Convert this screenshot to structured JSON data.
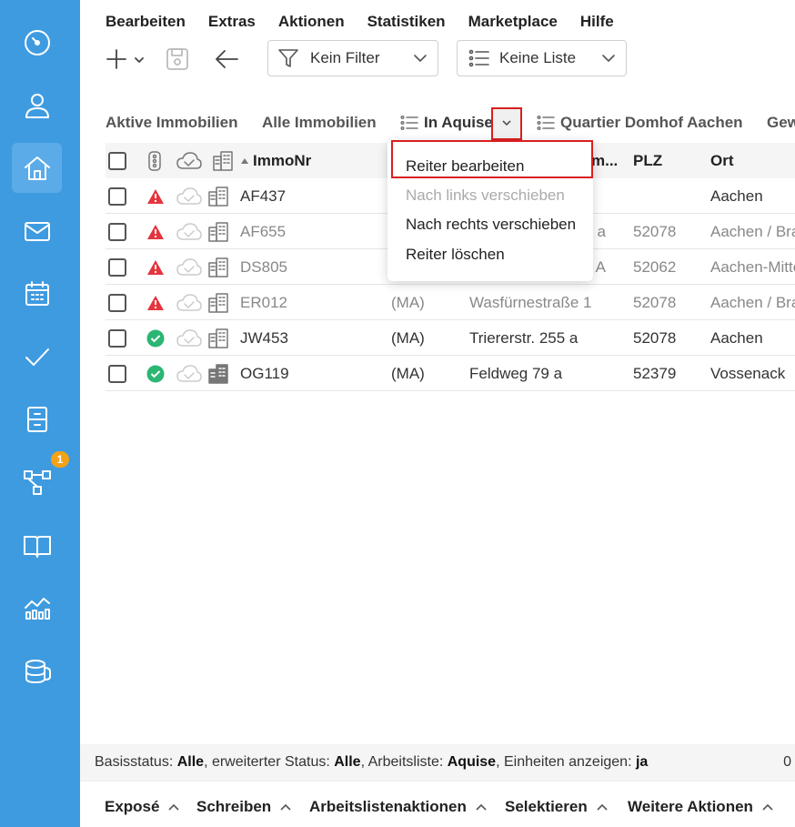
{
  "sidebar": {
    "items": [
      {
        "name": "dashboard-icon"
      },
      {
        "name": "contacts-icon"
      },
      {
        "name": "properties-icon",
        "active": true
      },
      {
        "name": "mail-icon"
      },
      {
        "name": "calendar-icon"
      },
      {
        "name": "tasks-icon"
      },
      {
        "name": "files-icon"
      },
      {
        "name": "process-icon",
        "badge": "1"
      },
      {
        "name": "book-icon"
      },
      {
        "name": "statistics-icon"
      },
      {
        "name": "database-icon"
      }
    ]
  },
  "menubar": {
    "items": [
      "Bearbeiten",
      "Extras",
      "Aktionen",
      "Statistiken",
      "Marketplace",
      "Hilfe"
    ]
  },
  "toolbar": {
    "filter_label": "Kein Filter",
    "list_label": "Keine Liste"
  },
  "tabs": {
    "items": [
      {
        "label": "Aktive Immobilien"
      },
      {
        "label": "Alle Immobilien"
      },
      {
        "label": "In Aquise",
        "active": true
      },
      {
        "label": "Quartier Domhof Aachen"
      },
      {
        "label": "Gew"
      }
    ]
  },
  "table": {
    "headers": {
      "immonr": "ImmoNr",
      "partial": "m...",
      "plz": "PLZ",
      "ort": "Ort"
    },
    "rows": [
      {
        "status": "warning",
        "immonr": "AF437",
        "ma": "",
        "street": "",
        "plz": "",
        "ort": "Aachen",
        "muted": false
      },
      {
        "status": "warning",
        "immonr": "AF655",
        "ma": "",
        "street": "a",
        "plz": "52078",
        "ort": "Aachen / Bra",
        "muted": true
      },
      {
        "status": "warning",
        "immonr": "DS805",
        "ma": "",
        "street": "A",
        "plz": "52062",
        "ort": "Aachen-Mitte",
        "muted": true
      },
      {
        "status": "warning",
        "immonr": "ER012",
        "ma": "(MA)",
        "street": "Wasfürnestraße 1",
        "plz": "52078",
        "ort": "Aachen / Bra",
        "muted": true
      },
      {
        "status": "ok",
        "immonr": "JW453",
        "ma": "(MA)",
        "street": "Triererstr. 255 a",
        "plz": "52078",
        "ort": "Aachen",
        "muted": false
      },
      {
        "status": "ok",
        "immonr": "OG119",
        "ma": "(MA)",
        "street": "Feldweg 79 a",
        "plz": "52379",
        "ort": "Vossenack",
        "muted": false
      }
    ]
  },
  "context_menu": {
    "items": [
      "Reiter bearbeiten",
      "Nach links verschieben",
      "Nach rechts verschieben",
      "Reiter löschen"
    ]
  },
  "status": {
    "basis_label": "Basisstatus:",
    "basis_value": "Alle",
    "erw_label": ", erweiterter Status:",
    "erw_value": "Alle",
    "liste_label": ", Arbeitsliste:",
    "liste_value": "Aquise",
    "einheiten_label": ", Einheiten anzeigen:",
    "einheiten_value": "ja",
    "right_value": "0"
  },
  "bottom": {
    "items": [
      "Exposé",
      "Schreiben",
      "Arbeitslistenaktionen",
      "Selektieren",
      "Weitere Aktionen"
    ]
  },
  "colors": {
    "sidebar": "#3f9be0",
    "warning": "#e5343d",
    "ok": "#2bb673",
    "highlight": "#d91f1f",
    "badge": "#f2a218"
  }
}
